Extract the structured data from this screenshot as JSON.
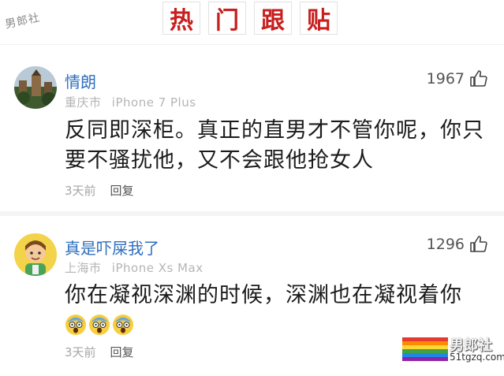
{
  "watermark": {
    "text": "男郎社"
  },
  "header": {
    "chars": [
      "热",
      "门",
      "跟",
      "贴"
    ],
    "accent_color": "#c81f1f"
  },
  "comments": [
    {
      "username": "情朗",
      "location": "重庆市",
      "device": "iPhone 7 Plus",
      "likes": "1967",
      "text": "反同即深柜。真正的直男才不管你呢，你只要不骚扰他，又不会跟他抢女人",
      "time": "3天前",
      "reply": "回复"
    },
    {
      "username": "真是吓屎我了",
      "location": "上海市",
      "device": "iPhone Xs Max",
      "likes": "1296",
      "text": "你在凝视深渊的时候，深渊也在凝视着你",
      "emoji_icons": [
        "scared-face-icon",
        "scared-face-icon",
        "scared-face-icon"
      ],
      "time": "3天前",
      "reply": "回复"
    }
  ],
  "brand": {
    "name": "男郎社",
    "url": "51tgzq.com"
  },
  "colors": {
    "username": "#2f6fbd",
    "meta": "#b5b5b5",
    "text": "#1b1b1b"
  }
}
